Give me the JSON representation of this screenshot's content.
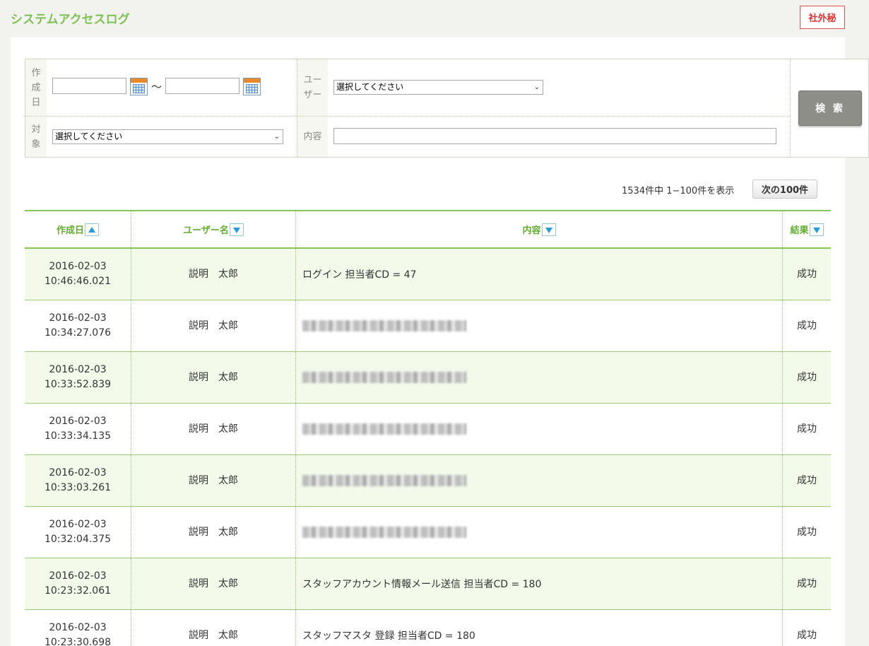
{
  "page": {
    "title": "システムアクセスログ",
    "confidential_badge": "社外秘"
  },
  "search": {
    "created_label": "作\n成\n日",
    "created_from_value": "",
    "created_to_value": "",
    "range_separator": "～",
    "user_label": "ユー\nザー",
    "user_select_value": "選択してください",
    "target_label": "対\n象",
    "target_select_value": "選択してください",
    "content_label": "内容",
    "content_value": "",
    "search_button": "検 索"
  },
  "paging": {
    "summary": "1534件中 1−100件を表示",
    "next_button": "次の100件"
  },
  "table": {
    "headers": {
      "created": "作成日",
      "user": "ユーザー名",
      "content": "内容",
      "result": "結果"
    },
    "rows": [
      {
        "date": "2016-02-03",
        "time": "10:46:46.021",
        "user": "説明　太郎",
        "content": "ログイン 担当者CD = 47",
        "redacted": false,
        "result": "成功"
      },
      {
        "date": "2016-02-03",
        "time": "10:34:27.076",
        "user": "説明　太郎",
        "content": "",
        "redacted": true,
        "result": "成功"
      },
      {
        "date": "2016-02-03",
        "time": "10:33:52.839",
        "user": "説明　太郎",
        "content": "",
        "redacted": true,
        "result": "成功"
      },
      {
        "date": "2016-02-03",
        "time": "10:33:34.135",
        "user": "説明　太郎",
        "content": "",
        "redacted": true,
        "result": "成功"
      },
      {
        "date": "2016-02-03",
        "time": "10:33:03.261",
        "user": "説明　太郎",
        "content": "",
        "redacted": true,
        "result": "成功"
      },
      {
        "date": "2016-02-03",
        "time": "10:32:04.375",
        "user": "説明　太郎",
        "content": "",
        "redacted": true,
        "result": "成功"
      },
      {
        "date": "2016-02-03",
        "time": "10:23:32.061",
        "user": "説明　太郎",
        "content": "スタッフアカウント情報メール送信 担当者CD = 180",
        "redacted": false,
        "result": "成功"
      },
      {
        "date": "2016-02-03",
        "time": "10:23:30.698",
        "user": "説明　太郎",
        "content": "スタッフマスタ 登録 担当者CD = 180",
        "redacted": false,
        "result": "成功"
      }
    ]
  },
  "colors": {
    "accent": "#7ec154",
    "table_border": "#86c654",
    "row_alt_bg": "#f3faea",
    "confidential": "#e03030"
  }
}
